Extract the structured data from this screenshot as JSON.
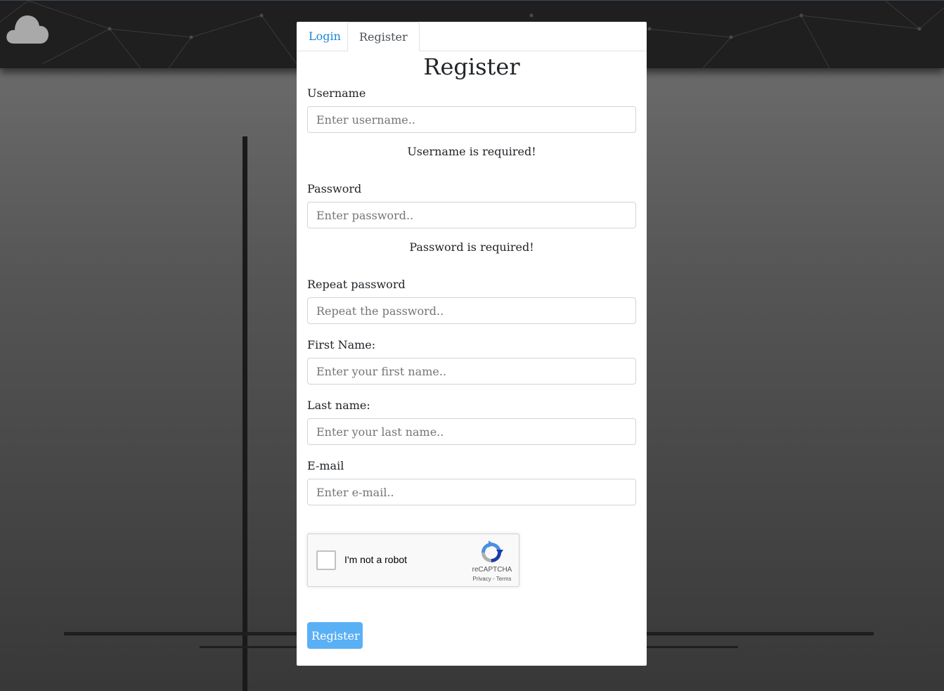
{
  "tabs": [
    {
      "label": "Login",
      "active": false
    },
    {
      "label": "Register",
      "active": true
    }
  ],
  "form": {
    "title": "Register",
    "username": {
      "label": "Username",
      "placeholder": "Enter username..",
      "value": "",
      "error": "Username is required!"
    },
    "password": {
      "label": "Password",
      "placeholder": "Enter password..",
      "value": "",
      "error": "Password is required!"
    },
    "repeat_password": {
      "label": "Repeat password",
      "placeholder": "Repeat the password..",
      "value": ""
    },
    "first_name": {
      "label": "First Name:",
      "placeholder": "Enter your first name..",
      "value": ""
    },
    "last_name": {
      "label": "Last name:",
      "placeholder": "Enter your last name..",
      "value": ""
    },
    "email": {
      "label": "E-mail",
      "placeholder": "Enter e-mail..",
      "value": ""
    },
    "submit_label": "Register"
  },
  "captcha": {
    "checkbox_label": "I'm not a robot",
    "brand": "reCAPTCHA",
    "privacy": "Privacy",
    "separator": " - ",
    "terms": "Terms",
    "checked": false
  },
  "colors": {
    "accent": "#1a86d9",
    "button": "#5ab0f5",
    "panel": "#ffffff",
    "topbar": "#1f1f1f"
  },
  "icons": {
    "logo": "cloud-icon",
    "captcha": "recaptcha-icon"
  }
}
